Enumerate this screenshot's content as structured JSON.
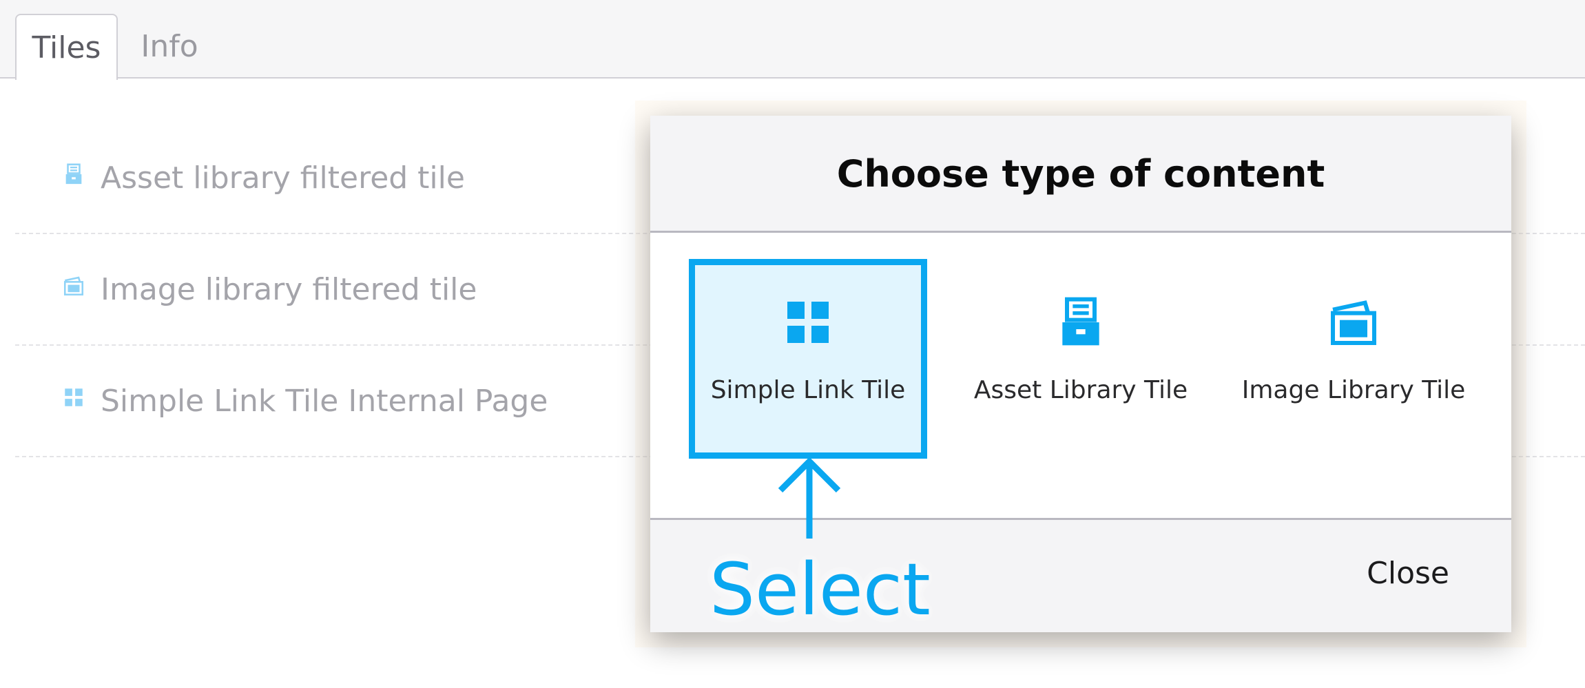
{
  "tabs": [
    {
      "label": "Tiles",
      "active": true
    },
    {
      "label": "Info",
      "active": false
    }
  ],
  "list": {
    "items": [
      {
        "label": "Asset library filtered tile",
        "icon": "asset-library-icon"
      },
      {
        "label": "Image library filtered tile",
        "icon": "image-library-icon"
      },
      {
        "label": "Simple Link Tile Internal Page",
        "icon": "grid-icon"
      }
    ]
  },
  "modal": {
    "title": "Choose type of content",
    "options": [
      {
        "label": "Simple Link Tile",
        "icon": "grid-icon",
        "selected": true
      },
      {
        "label": "Asset Library Tile",
        "icon": "asset-library-icon",
        "selected": false
      },
      {
        "label": "Image Library Tile",
        "icon": "image-library-icon",
        "selected": false
      }
    ],
    "close_label": "Close"
  },
  "annotation": {
    "label": "Select",
    "icon": "arrow-up-icon"
  },
  "colors": {
    "accent": "#0aa7f0",
    "selected_bg": "#e1f5fe",
    "list_icon": "#8fd3f7"
  }
}
